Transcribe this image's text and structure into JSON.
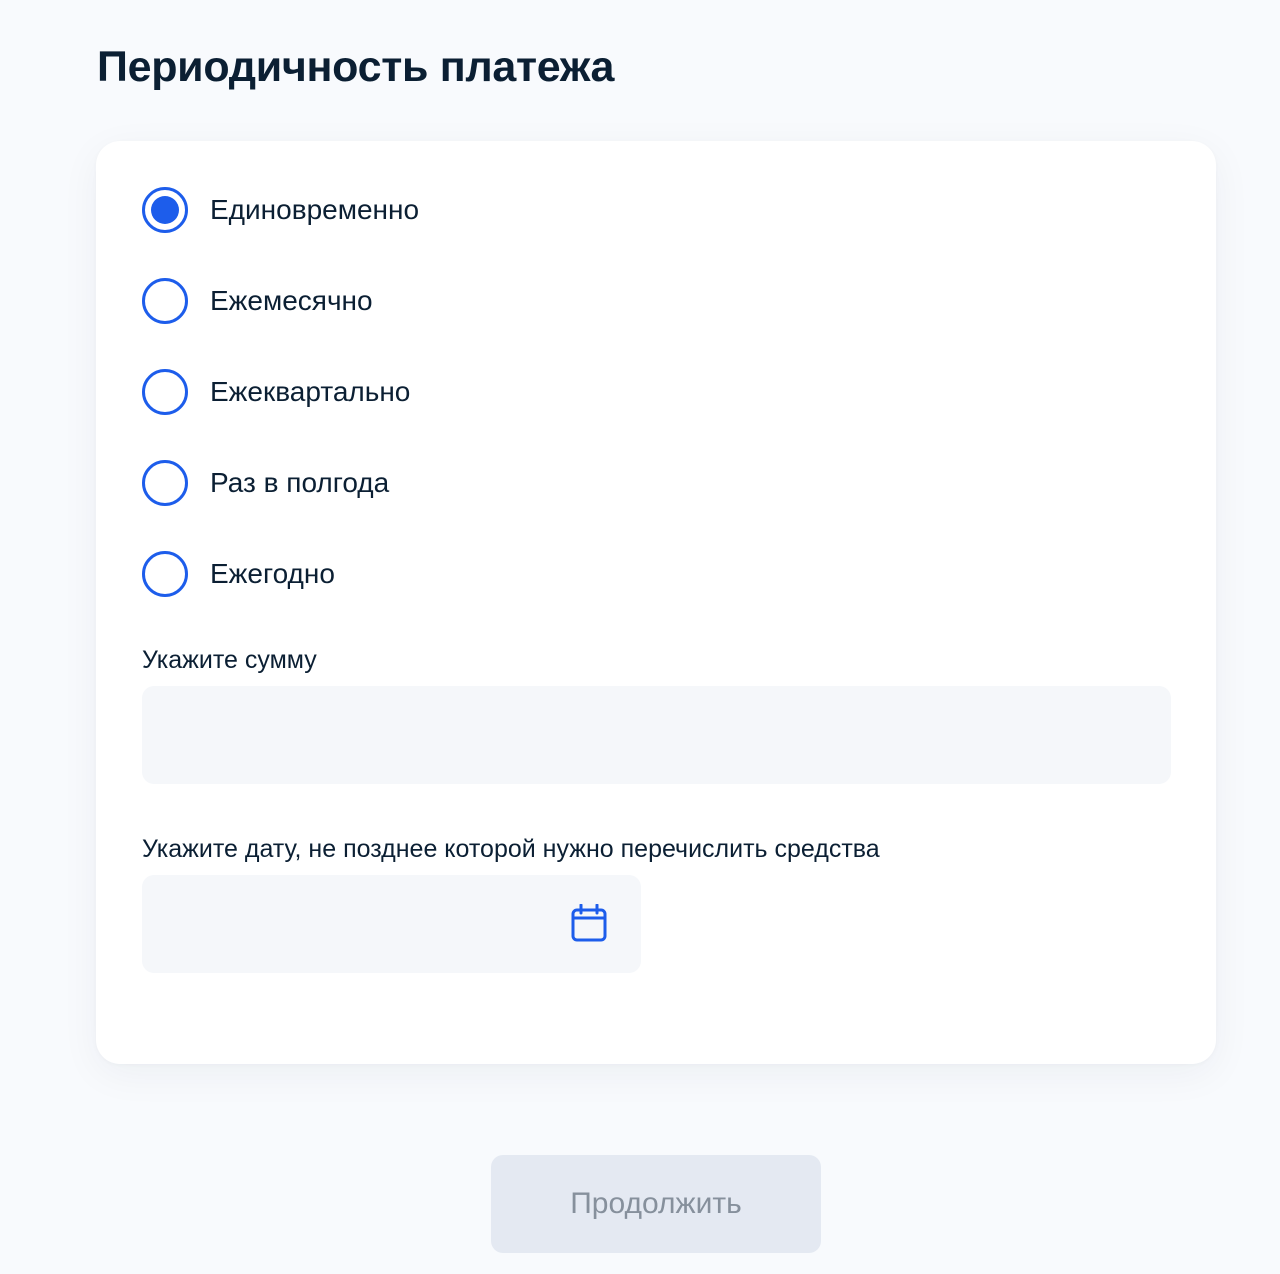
{
  "page": {
    "title": "Периодичность платежа"
  },
  "periodicity": {
    "selected_index": 0,
    "options": [
      {
        "label": "Единовременно",
        "selected": true
      },
      {
        "label": "Ежемесячно",
        "selected": false
      },
      {
        "label": "Ежеквартально",
        "selected": false
      },
      {
        "label": "Раз в полгода",
        "selected": false
      },
      {
        "label": "Ежегодно",
        "selected": false
      }
    ]
  },
  "amount": {
    "label": "Укажите сумму",
    "value": ""
  },
  "date": {
    "label": "Укажите дату, не позднее которой нужно перечислить средства",
    "value": "",
    "icon": "calendar-icon"
  },
  "actions": {
    "continue_label": "Продолжить",
    "continue_enabled": false
  },
  "colors": {
    "accent": "#1d5deb",
    "text": "#0b1f33",
    "input_bg": "#f5f7fa",
    "button_disabled_bg": "#e4e9f2",
    "button_disabled_text": "#86909c",
    "page_bg": "#f8fafd"
  }
}
